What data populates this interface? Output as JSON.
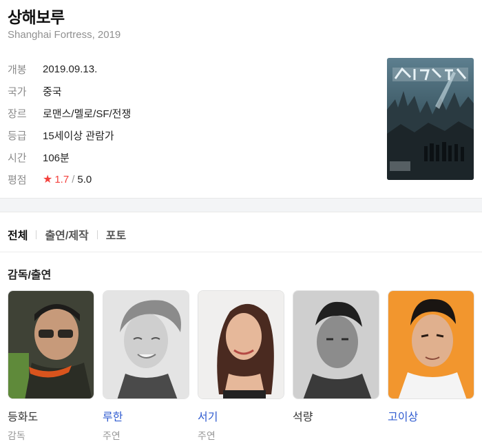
{
  "movie": {
    "title": "상해보루",
    "subtitle": "Shanghai Fortress, 2019"
  },
  "info": [
    {
      "label": "개봉",
      "value": "2019.09.13."
    },
    {
      "label": "국가",
      "value": "중국"
    },
    {
      "label": "장르",
      "value": "로맨스/멜로/SF/전쟁"
    },
    {
      "label": "등급",
      "value": "15세이상 관람가"
    },
    {
      "label": "시간",
      "value": "106분"
    }
  ],
  "rating": {
    "label": "평점",
    "icon": "star-icon",
    "score": "1.7",
    "separator": "/",
    "max": "5.0",
    "color": "#f4403c"
  },
  "tabs": [
    "전체",
    "출연/제작",
    "포토"
  ],
  "cast_section": {
    "title": "감독/출연",
    "people": [
      {
        "name": "등화도",
        "role": "감독",
        "linked": false
      },
      {
        "name": "루한",
        "role": "주연",
        "linked": true
      },
      {
        "name": "서기",
        "role": "주연",
        "linked": true
      },
      {
        "name": "석량",
        "role": "",
        "linked": false
      },
      {
        "name": "고이상",
        "role": "",
        "linked": true
      }
    ]
  },
  "colors": {
    "link": "#2f5bd0",
    "muted": "#909090"
  }
}
